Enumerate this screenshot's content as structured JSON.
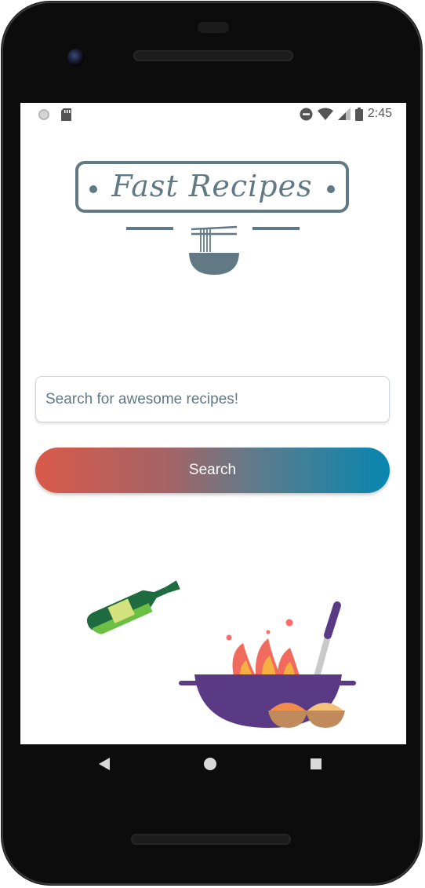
{
  "status_bar": {
    "time": "2:45",
    "left_icons": [
      "circle-indicator-icon",
      "sd-card-icon"
    ],
    "right_icons": [
      "do-not-disturb-icon",
      "wifi-icon",
      "signal-icon",
      "battery-icon"
    ]
  },
  "app": {
    "title": "Fast Recipes",
    "brand_color": "#617985"
  },
  "search": {
    "placeholder": "Search for awesome recipes!",
    "value": "",
    "button_label": "Search",
    "gradient_start": "#d9594a",
    "gradient_end": "#0786b0"
  },
  "illustrations": [
    "oil-bottle-icon",
    "wok-with-fire-icon",
    "spice-bowls-icon"
  ],
  "navigation": {
    "buttons": [
      "back-icon",
      "home-icon",
      "recents-icon"
    ]
  }
}
